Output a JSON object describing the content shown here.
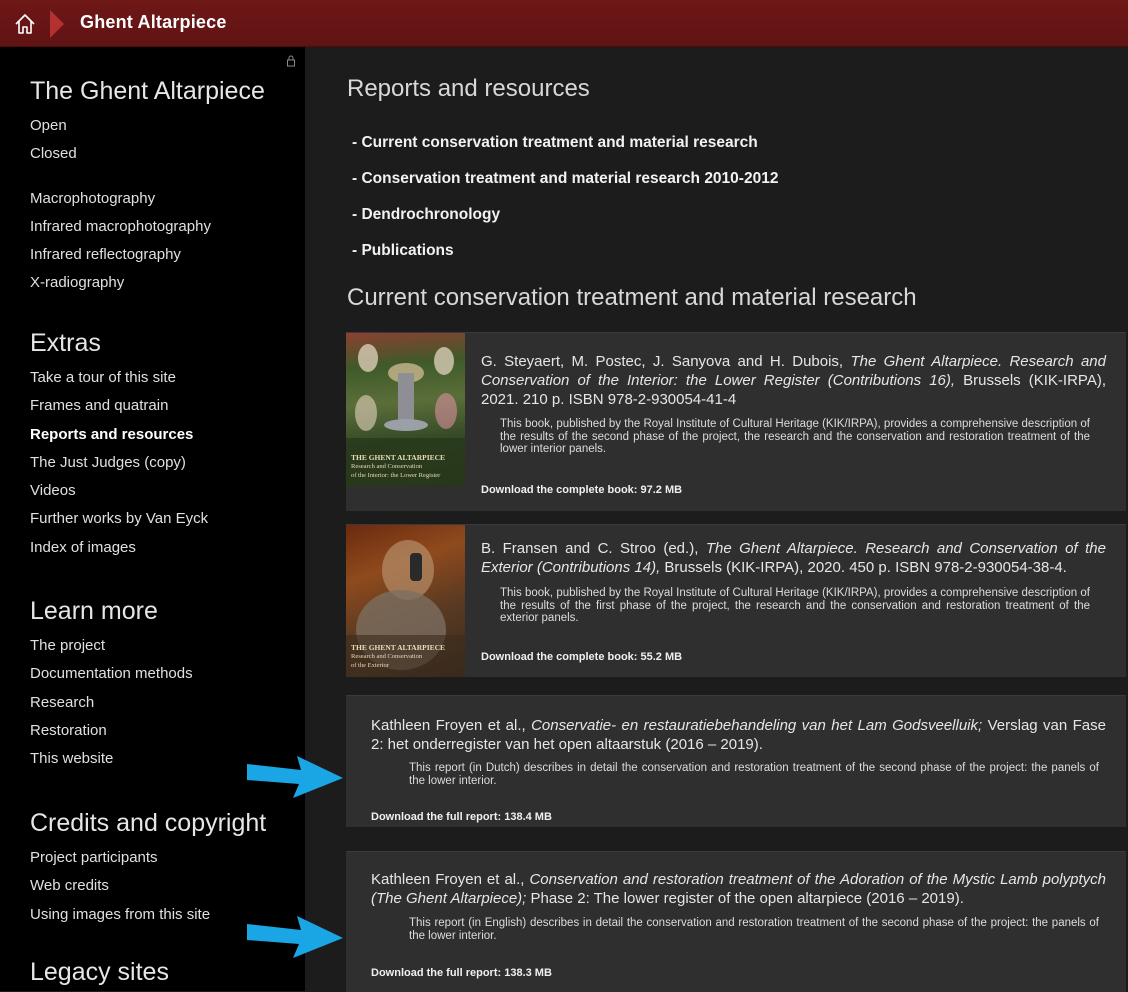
{
  "header": {
    "home_icon": "home-icon",
    "breadcrumb": "Ghent Altarpiece",
    "accent_color": "#6e1717"
  },
  "sidebar": {
    "lock_icon": "lock-icon",
    "sections": [
      {
        "heading": "The Ghent Altarpiece",
        "items": [
          "Open",
          "Closed",
          "",
          "Macrophotography",
          "Infrared macrophotography",
          "Infrared reflectography",
          "X-radiography"
        ]
      },
      {
        "heading": "Extras",
        "items": [
          "Take a tour of this site",
          "Frames and quatrain",
          "Reports and resources",
          "The Just Judges (copy)",
          "Videos",
          "Further works by Van Eyck",
          "Index of images"
        ]
      },
      {
        "heading": "Learn more",
        "items": [
          "The project",
          "Documentation methods",
          "Research",
          "Restoration",
          "This website"
        ]
      },
      {
        "heading": "Credits and copyright",
        "items": [
          "Project participants",
          "Web credits",
          "Using images from this site"
        ]
      },
      {
        "heading": "Legacy sites",
        "items": []
      }
    ],
    "active_item": "Reports and resources"
  },
  "main": {
    "title": "Reports and resources",
    "toc": [
      "- Current conservation treatment and material research",
      "- Conservation treatment and material research 2010-2012",
      "- Dendrochronology",
      "- Publications"
    ],
    "section_title": "Current conservation treatment and material research",
    "cards": [
      {
        "thumb_title": "THE GHENT ALTARPIECE",
        "thumb_sub1": "Research and Conservation",
        "thumb_sub2": "of the Interior: the Lower Register",
        "cite_pre": "G. Steyaert, M. Postec, J. Sanyova and H. Dubois,",
        "cite_italic": "The Ghent Altarpiece. Research and Conservation of the Interior: the Lower Register (Contributions 16),",
        "cite_post": "Brussels (KIK-IRPA), 2021. 210 p. ISBN 978-2-930054-41-4",
        "description": "This book, published by the Royal Institute of Cultural Heritage (KIK/IRPA), provides a comprehensive description of the results of the second phase of the project, the research and the conservation and restoration treatment of the lower interior panels.",
        "download": "Download the complete book: 97.2 MB"
      },
      {
        "thumb_title": "THE GHENT ALTARPIECE",
        "thumb_sub1": "Research and Conservation",
        "thumb_sub2": "of the Exterior",
        "cite_pre": "B. Fransen and C. Stroo (ed.),",
        "cite_italic": "The Ghent Altarpiece. Research and Conservation of the Exterior (Contributions 14),",
        "cite_post": "Brussels (KIK-IRPA), 2020. 450 p. ISBN 978-2-930054-38-4.",
        "description": "This book, published by the Royal Institute of Cultural Heritage (KIK/IRPA), provides a comprehensive description of the results of the first phase of the project, the research and the conservation and restoration treatment of the exterior panels.",
        "download": "Download the complete book: 55.2 MB"
      },
      {
        "cite_pre": "Kathleen Froyen et al.,",
        "cite_italic": "Conservatie- en restauratiebehandeling van het Lam Godsveelluik;",
        "cite_post": "Verslag van Fase 2: het onderregister van het open altaarstuk (2016 – 2019).",
        "description": "This report (in Dutch) describes in detail the conservation and restoration treatment of the second phase of the project: the panels of the lower interior.",
        "download": "Download the full report: 138.4 MB"
      },
      {
        "cite_pre": "Kathleen Froyen et al.,",
        "cite_italic": "Conservation and restoration treatment of the Adoration of the Mystic Lamb polyptych (The Ghent Altarpiece);",
        "cite_post": "Phase 2: The lower register of the open altarpiece (2016 – 2019).",
        "description": "This report (in English) describes in detail the conservation and restoration treatment of the second phase of the project: the panels of the lower interior.",
        "download": "Download the full report: 138.3 MB"
      }
    ]
  },
  "annotations": {
    "arrow_icon": "arrow-right-icon",
    "arrow_color": "#1aa6e4"
  }
}
